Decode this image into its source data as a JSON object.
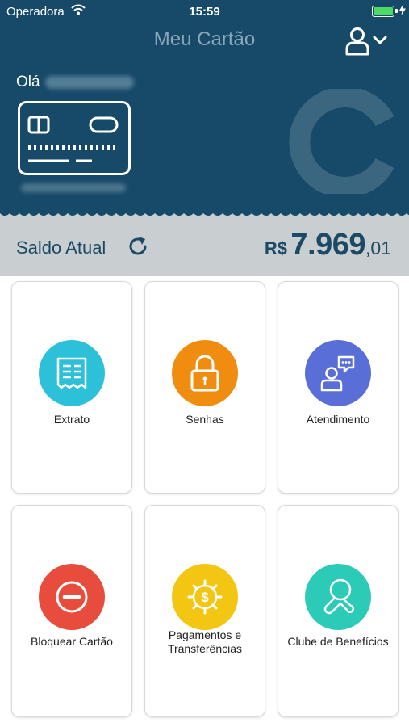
{
  "status_bar": {
    "carrier": "Operadora",
    "time": "15:59"
  },
  "header": {
    "title": "Meu Cartão",
    "greeting": "Olá"
  },
  "balance": {
    "label": "Saldo Atual",
    "currency": "R$",
    "integer": "7.969",
    "decimal": ",01"
  },
  "tiles": [
    {
      "label": "Extrato",
      "color": "#2cc1d9",
      "icon": "receipt-icon"
    },
    {
      "label": "Senhas",
      "color": "#f08c0f",
      "icon": "lock-icon"
    },
    {
      "label": "Atendimento",
      "color": "#5a6ed8",
      "icon": "support-chat-icon"
    },
    {
      "label": "Bloquear Cartão",
      "color": "#e74c3c",
      "icon": "block-icon"
    },
    {
      "label": "Pagamentos e Transferências",
      "color": "#f3c613",
      "icon": "payment-gear-icon"
    },
    {
      "label": "Clube de Benefícios",
      "color": "#2bcbb8",
      "icon": "benefits-icon"
    }
  ],
  "colors": {
    "header_bg": "#164a68",
    "balance_bg": "#c9ced1",
    "balance_text": "#1c4a66",
    "title_text": "#8aa6b8"
  }
}
